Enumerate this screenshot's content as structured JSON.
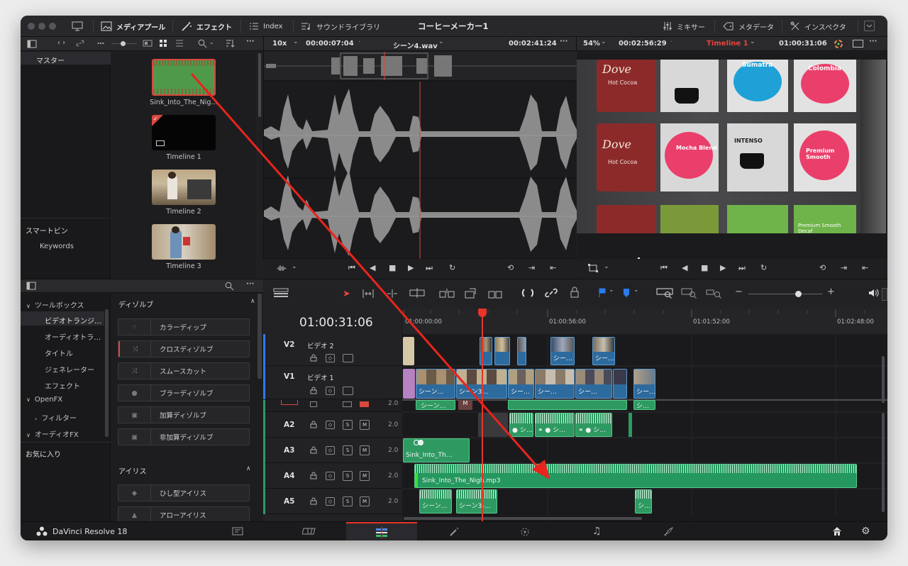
{
  "window": {
    "title": "コーヒーメーカー1"
  },
  "toolbar": {
    "media_pool": "メディアプール",
    "effects": "エフェクト",
    "index": "Index",
    "sound_library": "サウンドライブラリ",
    "mixer": "ミキサー",
    "metadata": "メタデータ",
    "inspector": "インスペクタ"
  },
  "subbar": {
    "more_label": "…",
    "zoom": "10x",
    "src_timecode": "00:00:07:04",
    "clip_name": "シーン4.wav",
    "src_duration": "00:02:41:24",
    "viewer_zoom": "54%",
    "viewer_timecode": "00:02:56:29",
    "timeline_name": "Timeline 1",
    "rec_timecode": "01:00:31:06"
  },
  "bins": {
    "master": "マスター",
    "smart_bins": "スマートビン",
    "keywords": "Keywords"
  },
  "media_pool": {
    "items": [
      {
        "label": "Sink_Into_The_Nig…"
      },
      {
        "label": "Timeline 1"
      },
      {
        "label": "Timeline 2"
      },
      {
        "label": "Timeline 3"
      }
    ]
  },
  "viewer": {
    "labels": [
      "Dove",
      "Hot Cocoa",
      "Sumatra",
      "Colombia",
      "Mocha Blend",
      "INTENSO",
      "Premium Smooth",
      "Premium Smooth Decaf"
    ]
  },
  "effects_tree": {
    "toolbox": "ツールボックス",
    "video_transitions": "ビデオトランジ…",
    "audio_transitions": "オーディオトラ…",
    "titles": "タイトル",
    "generators": "ジェネレーター",
    "effects": "エフェクト",
    "openfx": "OpenFX",
    "filters": "フィルター",
    "audiofx": "オーディオFX",
    "favorites": "お気に入り"
  },
  "effects_list": {
    "dissolve_header": "ディゾルブ",
    "dissolves": [
      "カラーディップ",
      "クロスディゾルブ",
      "スムースカット",
      "ブラーディゾルブ",
      "加算ディゾルブ",
      "非加算ディゾルブ"
    ],
    "iris_header": "アイリス",
    "iris": [
      "ひし型アイリス",
      "アローアイリス"
    ]
  },
  "timeline": {
    "timecode": "01:00:31:06",
    "ruler": [
      "01:00:00:00",
      "01:00:56:00",
      "01:01:52:00",
      "01:02:48:00"
    ],
    "tracks": [
      {
        "id": "V2",
        "name": "ビデオ 2"
      },
      {
        "id": "V1",
        "name": "ビデオ 1"
      },
      {
        "id": "A2",
        "level": "2.0"
      },
      {
        "id": "A3",
        "level": "2.0"
      },
      {
        "id": "A4",
        "level": "2.0"
      },
      {
        "id": "A5",
        "level": "2.0"
      }
    ],
    "a1_level": "2.0",
    "solo": "S",
    "mute": "M",
    "clip_short": "シ…",
    "clip_short2": "シー…",
    "clip_scene": "シーン…",
    "clip_scene3": "シーン3…",
    "clip_scene3b": "シーン3-…",
    "a3_clip": "Sink_Into_Th…",
    "a4_clip": "Sink_Into_The_Nigh.mp3"
  },
  "footer": {
    "app_name": "DaVinci Resolve 18"
  }
}
